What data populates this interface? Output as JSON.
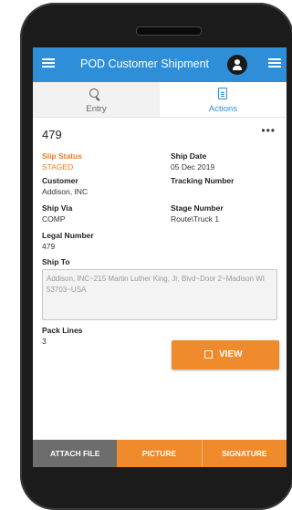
{
  "appbar": {
    "title": "POD Customer Shipment",
    "left_icon": "hamburger-menu-icon",
    "avatar_icon": "user-avatar-icon",
    "right_icon": "hamburger-menu-icon"
  },
  "tabs": [
    {
      "label": "Entry",
      "icon": "search-icon"
    },
    {
      "label": "Actions",
      "icon": "document-icon",
      "active": true
    }
  ],
  "slip": {
    "number": "479"
  },
  "fields": {
    "slip_status": {
      "label": "Slip Status",
      "value": "STAGED"
    },
    "ship_date": {
      "label": "Ship Date",
      "value": "05 Dec 2019"
    },
    "customer": {
      "label": "Customer",
      "value": "Addison, INC"
    },
    "tracking_number": {
      "label": "Tracking Number",
      "value": ""
    },
    "ship_via": {
      "label": "Ship Via",
      "value": "COMP"
    },
    "stage_number": {
      "label": "Stage Number",
      "value": "Route\\Truck 1"
    },
    "legal_number": {
      "label": "Legal Number",
      "value": "479"
    },
    "ship_to": {
      "label": "Ship To",
      "value": "Addison, INC~215 Martin Luther King, Jr. Blvd~Door 2~Madison WI 53703~USA"
    },
    "pack_lines": {
      "label": "Pack Lines",
      "value": "3"
    }
  },
  "view_button": {
    "label": "VIEW"
  },
  "bottom_actions": {
    "attach": "ATTACH FILE",
    "picture": "PICTURE",
    "signature": "SIGNATURE"
  },
  "colors": {
    "primary": "#2e8fd8",
    "accent": "#ef8a2d",
    "attach_bg": "#6d6d6d"
  }
}
